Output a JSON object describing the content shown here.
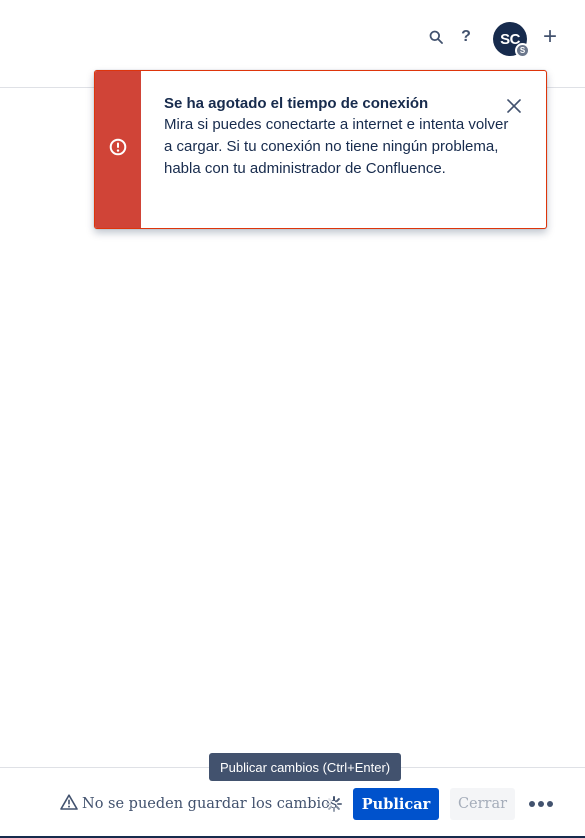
{
  "header": {
    "icons": {
      "search": "search-icon",
      "help": "question-icon",
      "create": "plus-icon"
    },
    "help_label": "?",
    "create_label": "+",
    "avatar": {
      "initials": "SC",
      "badge": "S",
      "color": "#172b4d"
    }
  },
  "flag": {
    "type": "error",
    "icon": "error-icon",
    "accent_color": "#d04437",
    "title": "Se ha agotado el tiempo de conexión",
    "description": "Mira si puedes conectarte a internet e intenta volver a cargar. Si tu conexión no tiene ningún problema, habla con tu administrador de Confluence.",
    "close_icon": "close-icon"
  },
  "tooltip": {
    "text": "Publicar cambios (Ctrl+Enter)"
  },
  "footer": {
    "warning_icon": "warning-icon",
    "save_status": "No se pueden guardar los cambios",
    "spinner_icon": "spinner-icon",
    "publish_label": "Publicar",
    "close_label": "Cerrar",
    "more_icon": "more-icon",
    "primary_color": "#0052cc"
  }
}
